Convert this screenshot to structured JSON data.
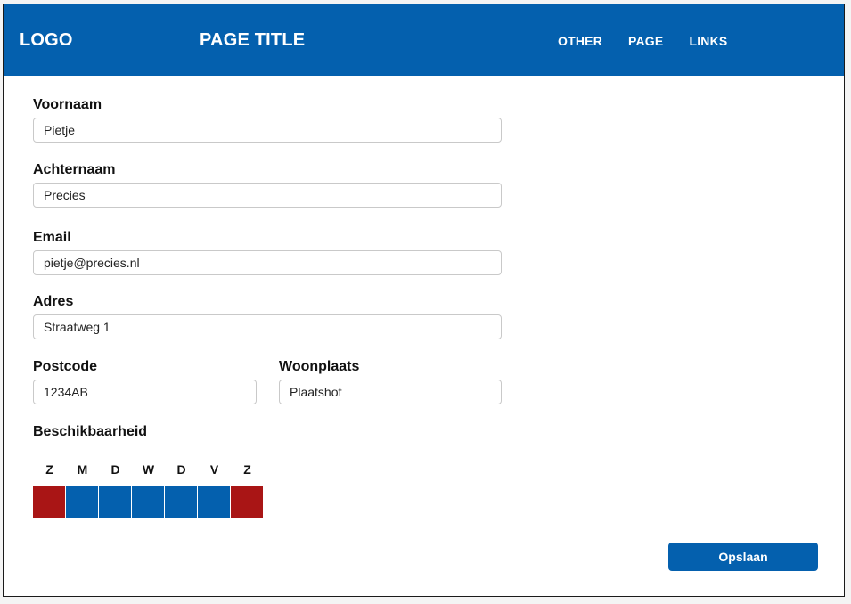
{
  "header": {
    "logo": "LOGO",
    "title": "PAGE TITLE",
    "nav": [
      "OTHER",
      "PAGE",
      "LINKS"
    ]
  },
  "form": {
    "voornaam": {
      "label": "Voornaam",
      "value": "Pietje"
    },
    "achternaam": {
      "label": "Achternaam",
      "value": "Precies"
    },
    "email": {
      "label": "Email",
      "value": "pietje@precies.nl"
    },
    "adres": {
      "label": "Adres",
      "value": "Straatweg 1"
    },
    "postcode": {
      "label": "Postcode",
      "value": "1234AB"
    },
    "woonplaats": {
      "label": "Woonplaats",
      "value": "Plaatshof"
    }
  },
  "availability": {
    "label": "Beschikbaarheid",
    "days": [
      {
        "letter": "Z",
        "available": false
      },
      {
        "letter": "M",
        "available": true
      },
      {
        "letter": "D",
        "available": true
      },
      {
        "letter": "W",
        "available": true
      },
      {
        "letter": "D",
        "available": true
      },
      {
        "letter": "V",
        "available": true
      },
      {
        "letter": "Z",
        "available": false
      }
    ],
    "colors": {
      "available": "#0460ae",
      "unavailable": "#a91515"
    }
  },
  "actions": {
    "save_label": "Opslaan"
  },
  "theme": {
    "primary": "#0460ae"
  }
}
